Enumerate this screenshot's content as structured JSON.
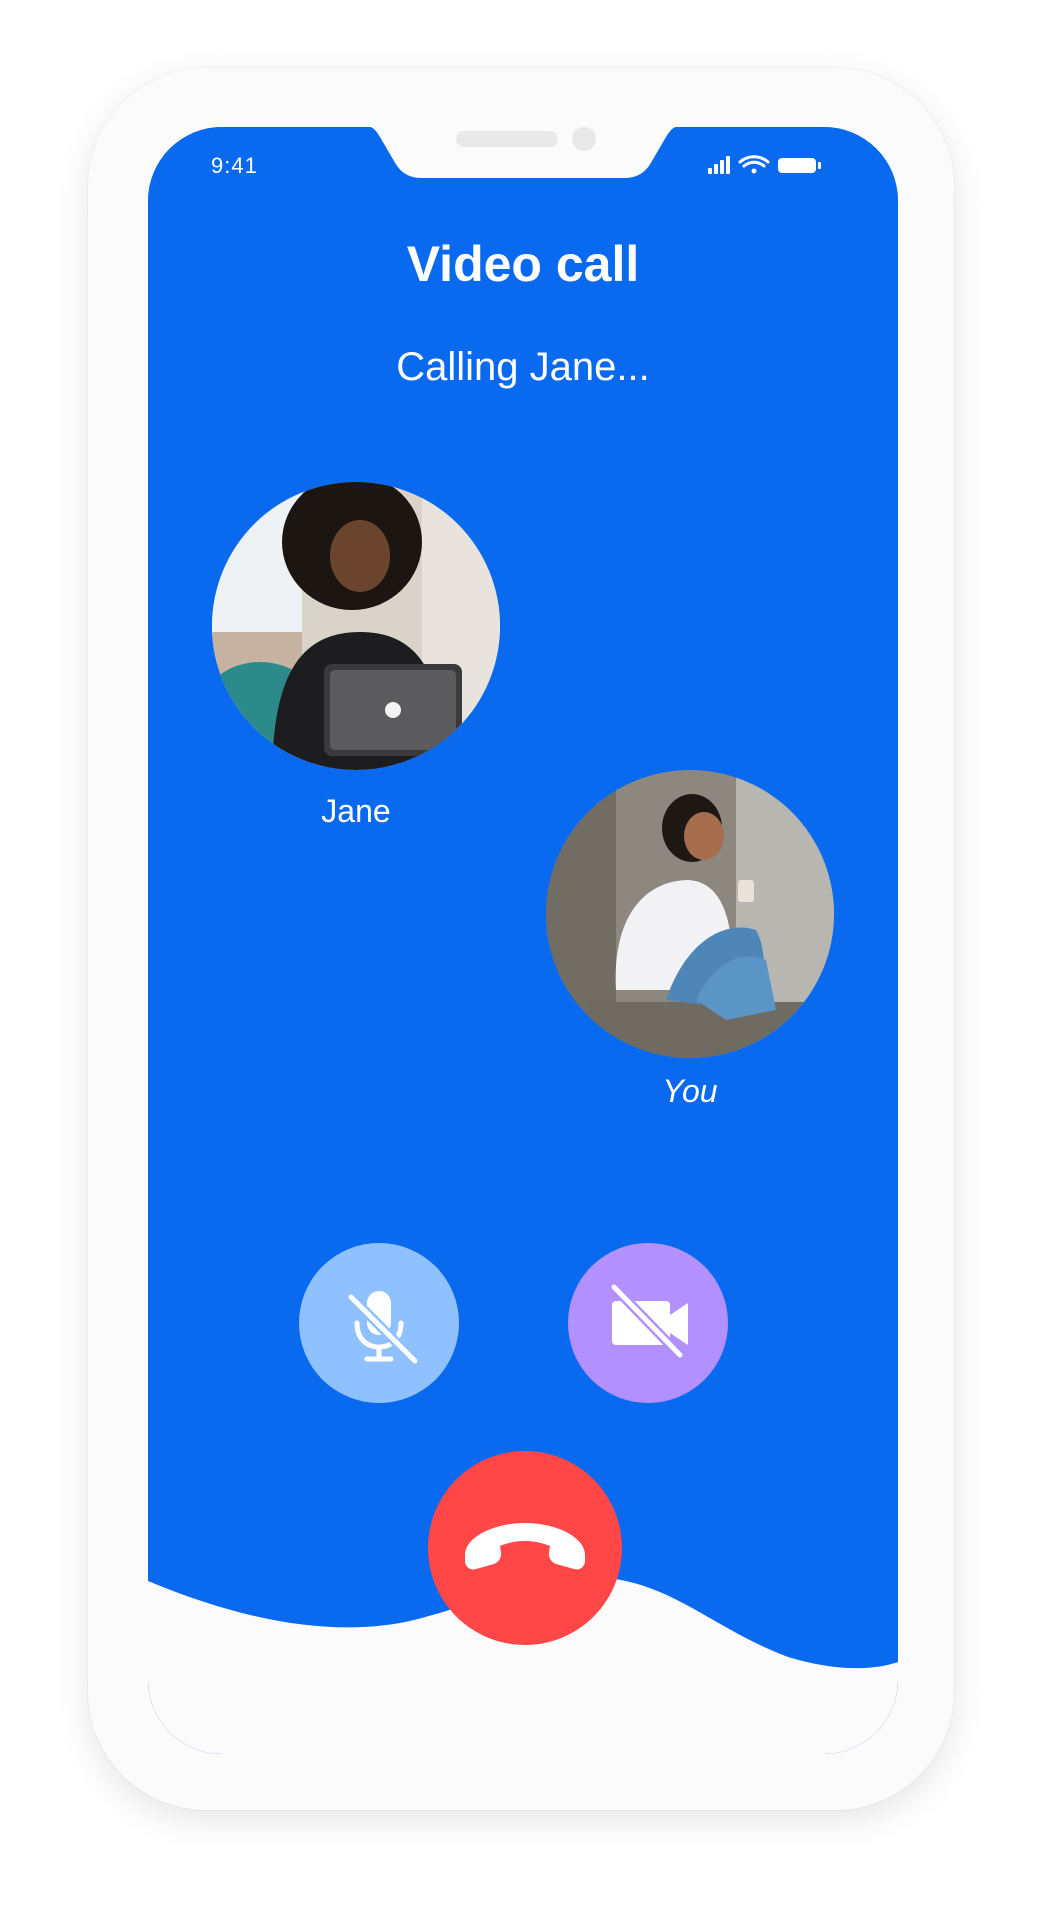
{
  "status_bar": {
    "time": "9:41",
    "icons": [
      "signal-icon",
      "wifi-icon",
      "battery-icon"
    ]
  },
  "header": {
    "title": "Video call",
    "subtitle": "Calling Jane..."
  },
  "participants": [
    {
      "name": "Jane",
      "avatar": "photo-woman-laptop"
    },
    {
      "name": "You",
      "avatar": "photo-woman-sitting"
    }
  ],
  "controls": {
    "mute": {
      "icon": "mic-off-icon",
      "color": "#8fc1ff"
    },
    "video": {
      "icon": "video-off-icon",
      "color": "#b291ff"
    },
    "end_call": {
      "icon": "phone-hangup-icon",
      "color": "#ff4747"
    }
  },
  "colors": {
    "background": "#0a6aef",
    "bottom_wave": "#fbfbfb",
    "text": "#ffffff"
  }
}
